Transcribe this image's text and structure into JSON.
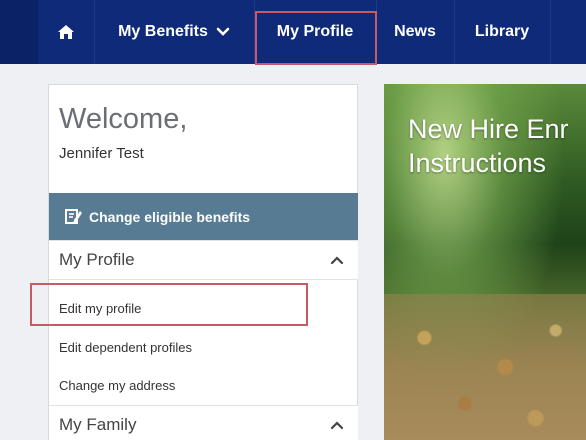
{
  "nav": {
    "home_icon": "home-icon",
    "my_benefits": "My Benefits",
    "my_benefits_icon": "chevron-down-icon",
    "my_profile": "My Profile",
    "news": "News",
    "library": "Library"
  },
  "sidebar": {
    "welcome": "Welcome,",
    "user_name": "Jennifer Test",
    "change_button": "Change eligible benefits",
    "change_button_icon": "edit-icon",
    "sections": [
      {
        "title": "My Profile",
        "icon": "chevron-up-icon",
        "links": [
          "Edit my profile",
          "Edit dependent profiles",
          "Change my address"
        ]
      },
      {
        "title": "My Family",
        "icon": "chevron-up-icon"
      }
    ]
  },
  "hero": {
    "title_line1": "New Hire Enr",
    "title_line2": "Instructions"
  },
  "colors": {
    "nav_bg": "#0e2a78",
    "button_bg": "#577b92",
    "highlight_border": "#c85a64"
  }
}
